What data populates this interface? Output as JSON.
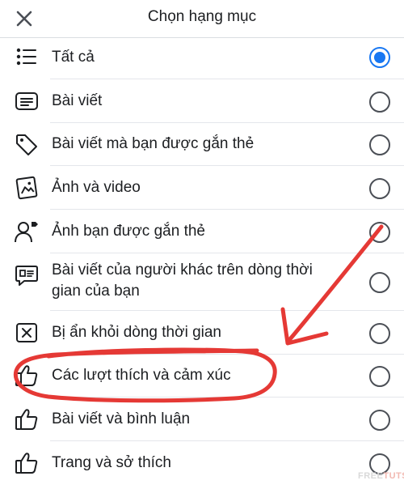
{
  "header": {
    "title": "Chọn hạng mục",
    "close_icon": "close-icon"
  },
  "rows": [
    {
      "label": "Tất cả",
      "icon": "list-icon",
      "selected": true
    },
    {
      "label": "Bài viết",
      "icon": "post-icon",
      "selected": false
    },
    {
      "label": "Bài viết mà bạn được gắn thẻ",
      "icon": "tag-icon",
      "selected": false
    },
    {
      "label": "Ảnh và video",
      "icon": "photo-icon",
      "selected": false
    },
    {
      "label": "Ảnh bạn được gắn thẻ",
      "icon": "person-tag-icon",
      "selected": false
    },
    {
      "label": "Bài viết của người khác trên dòng thời",
      "label_line2": "gian của bạn",
      "icon": "id-card-icon",
      "selected": false
    },
    {
      "label": "Bị ẩn khỏi dòng thời gian",
      "icon": "hidden-box-icon",
      "selected": false
    },
    {
      "label": "Các lượt thích và cảm xúc",
      "icon": "thumb-up-icon",
      "selected": false
    },
    {
      "label": "Bài viết và bình luận",
      "icon": "thumb-up-icon",
      "selected": false
    },
    {
      "label": "Trang và sở thích",
      "icon": "thumb-up-icon",
      "selected": false
    }
  ],
  "watermark": {
    "part1": "FREE",
    "part2": "TUTS"
  },
  "colors": {
    "accent_blue": "#1877f2",
    "annotation_red": "#e53935",
    "text": "#1c1e21"
  }
}
